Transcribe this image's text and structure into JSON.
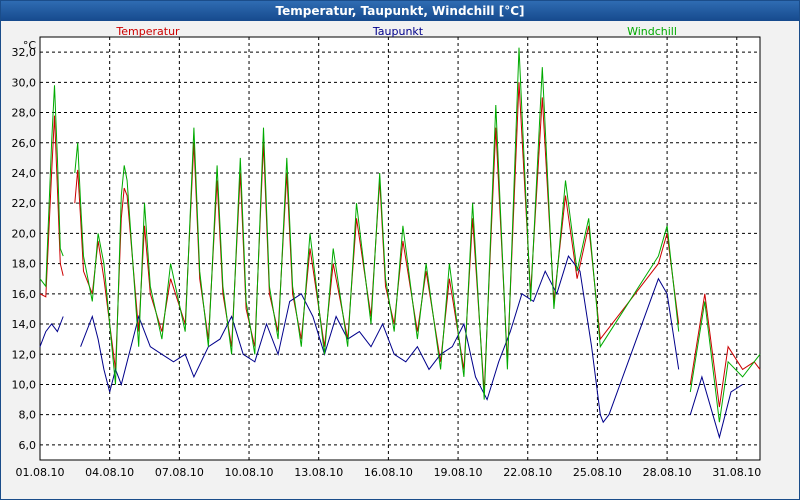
{
  "window": {
    "title": "Temperatur, Taupunkt, Windchill [°C]"
  },
  "chart_data": {
    "type": "line",
    "unit_label": "°C",
    "ylim": [
      5,
      33
    ],
    "xlim": [
      "2010-08-01",
      "2010-09-01"
    ],
    "grid": true,
    "legend_placement": "top",
    "y_ticks": [
      "32,0",
      "30,0",
      "28,0",
      "26,0",
      "24,0",
      "22,0",
      "20,0",
      "18,0",
      "16,0",
      "14,0",
      "12,0",
      "10,0",
      "8,0",
      "6,0"
    ],
    "x_ticks": [
      "01.08.10",
      "04.08.10",
      "07.08.10",
      "10.08.10",
      "13.08.10",
      "16.08.10",
      "19.08.10",
      "22.08.10",
      "25.08.10",
      "28.08.10",
      "31.08.10"
    ],
    "series": [
      {
        "name": "Temperatur",
        "color": "#cc0000",
        "points": [
          [
            "2010-08-01 00:00",
            16.0
          ],
          [
            "2010-08-01 06:00",
            15.8
          ],
          [
            "2010-08-01 12:00",
            24.0
          ],
          [
            "2010-08-01 15:00",
            27.8
          ],
          [
            "2010-08-01 18:00",
            23.0
          ],
          [
            "2010-08-01 21:00",
            18.0
          ],
          [
            "2010-08-02 00:00",
            17.2
          ],
          [
            "2010-08-02 06:00",
            null
          ],
          [
            "2010-08-02 12:00",
            22.0
          ],
          [
            "2010-08-02 15:00",
            24.2
          ],
          [
            "2010-08-02 18:00",
            21.0
          ],
          [
            "2010-08-02 21:00",
            17.5
          ],
          [
            "2010-08-03 06:00",
            16.0
          ],
          [
            "2010-08-03 12:00",
            19.5
          ],
          [
            "2010-08-03 18:00",
            17.0
          ],
          [
            "2010-08-04 06:00",
            11.0
          ],
          [
            "2010-08-04 12:00",
            21.0
          ],
          [
            "2010-08-04 15:00",
            23.0
          ],
          [
            "2010-08-04 18:00",
            22.5
          ],
          [
            "2010-08-05 06:00",
            13.5
          ],
          [
            "2010-08-05 12:00",
            20.5
          ],
          [
            "2010-08-05 18:00",
            16.0
          ],
          [
            "2010-08-06 06:00",
            13.5
          ],
          [
            "2010-08-06 15:00",
            17.0
          ],
          [
            "2010-08-07 06:00",
            14.0
          ],
          [
            "2010-08-07 15:00",
            26.0
          ],
          [
            "2010-08-07 21:00",
            17.0
          ],
          [
            "2010-08-08 06:00",
            13.0
          ],
          [
            "2010-08-08 15:00",
            23.5
          ],
          [
            "2010-08-08 21:00",
            16.0
          ],
          [
            "2010-08-09 06:00",
            12.5
          ],
          [
            "2010-08-09 15:00",
            24.0
          ],
          [
            "2010-08-09 21:00",
            15.0
          ],
          [
            "2010-08-10 06:00",
            12.5
          ],
          [
            "2010-08-10 15:00",
            26.0
          ],
          [
            "2010-08-10 21:00",
            16.0
          ],
          [
            "2010-08-11 06:00",
            13.5
          ],
          [
            "2010-08-11 15:00",
            24.0
          ],
          [
            "2010-08-11 21:00",
            16.0
          ],
          [
            "2010-08-12 06:00",
            13.0
          ],
          [
            "2010-08-12 15:00",
            19.0
          ],
          [
            "2010-08-13 06:00",
            12.5
          ],
          [
            "2010-08-13 15:00",
            18.0
          ],
          [
            "2010-08-14 06:00",
            13.0
          ],
          [
            "2010-08-14 15:00",
            21.0
          ],
          [
            "2010-08-15 06:00",
            14.5
          ],
          [
            "2010-08-15 15:00",
            23.5
          ],
          [
            "2010-08-15 21:00",
            16.5
          ],
          [
            "2010-08-16 06:00",
            14.0
          ],
          [
            "2010-08-16 15:00",
            19.5
          ],
          [
            "2010-08-17 06:00",
            13.5
          ],
          [
            "2010-08-17 15:00",
            17.5
          ],
          [
            "2010-08-18 06:00",
            11.5
          ],
          [
            "2010-08-18 15:00",
            17.0
          ],
          [
            "2010-08-19 06:00",
            11.0
          ],
          [
            "2010-08-19 15:00",
            21.0
          ],
          [
            "2010-08-20 03:00",
            9.5
          ],
          [
            "2010-08-20 15:00",
            27.0
          ],
          [
            "2010-08-21 03:00",
            11.5
          ],
          [
            "2010-08-21 15:00",
            30.0
          ],
          [
            "2010-08-22 03:00",
            16.0
          ],
          [
            "2010-08-22 15:00",
            29.0
          ],
          [
            "2010-08-23 03:00",
            15.5
          ],
          [
            "2010-08-23 15:00",
            22.5
          ],
          [
            "2010-08-24 03:00",
            17.0
          ],
          [
            "2010-08-24 15:00",
            20.5
          ],
          [
            "2010-08-25 03:00",
            13.0
          ],
          [
            "2010-08-27 15:00",
            18.0
          ],
          [
            "2010-08-28 00:00",
            20.0
          ],
          [
            "2010-08-28 12:00",
            14.0
          ],
          [
            "2010-08-28 18:00",
            null
          ],
          [
            "2010-08-29 00:00",
            10.0
          ],
          [
            "2010-08-29 15:00",
            16.0
          ],
          [
            "2010-08-30 06:00",
            8.5
          ],
          [
            "2010-08-30 15:00",
            12.5
          ],
          [
            "2010-08-31 06:00",
            11.0
          ],
          [
            "2010-08-31 18:00",
            11.5
          ],
          [
            "2010-09-01 00:00",
            11.0
          ]
        ]
      },
      {
        "name": "Taupunkt",
        "color": "#00008b",
        "points": [
          [
            "2010-08-01 00:00",
            12.5
          ],
          [
            "2010-08-01 06:00",
            13.5
          ],
          [
            "2010-08-01 12:00",
            14.0
          ],
          [
            "2010-08-01 18:00",
            13.5
          ],
          [
            "2010-08-02 00:00",
            14.5
          ],
          [
            "2010-08-02 06:00",
            null
          ],
          [
            "2010-08-02 18:00",
            12.5
          ],
          [
            "2010-08-03 06:00",
            14.5
          ],
          [
            "2010-08-03 12:00",
            13.0
          ],
          [
            "2010-08-03 18:00",
            11.0
          ],
          [
            "2010-08-04 00:00",
            9.5
          ],
          [
            "2010-08-04 06:00",
            11.0
          ],
          [
            "2010-08-04 12:00",
            10.0
          ],
          [
            "2010-08-05 06:00",
            14.5
          ],
          [
            "2010-08-05 12:00",
            13.5
          ],
          [
            "2010-08-05 18:00",
            12.5
          ],
          [
            "2010-08-06 06:00",
            12.0
          ],
          [
            "2010-08-06 18:00",
            11.5
          ],
          [
            "2010-08-07 06:00",
            12.0
          ],
          [
            "2010-08-07 15:00",
            10.5
          ],
          [
            "2010-08-08 06:00",
            12.5
          ],
          [
            "2010-08-08 18:00",
            13.0
          ],
          [
            "2010-08-09 06:00",
            14.5
          ],
          [
            "2010-08-09 18:00",
            12.0
          ],
          [
            "2010-08-10 06:00",
            11.5
          ],
          [
            "2010-08-10 18:00",
            14.0
          ],
          [
            "2010-08-11 06:00",
            12.0
          ],
          [
            "2010-08-11 18:00",
            15.5
          ],
          [
            "2010-08-12 06:00",
            16.0
          ],
          [
            "2010-08-12 18:00",
            14.5
          ],
          [
            "2010-08-13 06:00",
            12.0
          ],
          [
            "2010-08-13 18:00",
            14.5
          ],
          [
            "2010-08-14 06:00",
            13.0
          ],
          [
            "2010-08-14 18:00",
            13.5
          ],
          [
            "2010-08-15 06:00",
            12.5
          ],
          [
            "2010-08-15 18:00",
            14.0
          ],
          [
            "2010-08-16 06:00",
            12.0
          ],
          [
            "2010-08-16 18:00",
            11.5
          ],
          [
            "2010-08-17 06:00",
            12.5
          ],
          [
            "2010-08-17 18:00",
            11.0
          ],
          [
            "2010-08-18 06:00",
            12.0
          ],
          [
            "2010-08-18 18:00",
            12.5
          ],
          [
            "2010-08-19 06:00",
            14.0
          ],
          [
            "2010-08-19 18:00",
            10.5
          ],
          [
            "2010-08-20 06:00",
            9.0
          ],
          [
            "2010-08-20 18:00",
            11.5
          ],
          [
            "2010-08-21 06:00",
            13.5
          ],
          [
            "2010-08-21 18:00",
            16.0
          ],
          [
            "2010-08-22 06:00",
            15.5
          ],
          [
            "2010-08-22 18:00",
            17.5
          ],
          [
            "2010-08-23 06:00",
            16.0
          ],
          [
            "2010-08-23 18:00",
            18.5
          ],
          [
            "2010-08-24 06:00",
            17.5
          ],
          [
            "2010-08-24 18:00",
            12.5
          ],
          [
            "2010-08-25 03:00",
            8.0
          ],
          [
            "2010-08-25 06:00",
            7.5
          ],
          [
            "2010-08-25 12:00",
            8.0
          ],
          [
            "2010-08-27 15:00",
            17.0
          ],
          [
            "2010-08-28 00:00",
            16.0
          ],
          [
            "2010-08-28 12:00",
            11.0
          ],
          [
            "2010-08-28 18:00",
            null
          ],
          [
            "2010-08-29 00:00",
            8.0
          ],
          [
            "2010-08-29 12:00",
            10.5
          ],
          [
            "2010-08-30 06:00",
            6.5
          ],
          [
            "2010-08-30 18:00",
            9.5
          ],
          [
            "2010-08-31 06:00",
            10.0
          ],
          [
            "2010-08-31 18:00",
            null
          ],
          [
            "2010-09-01 00:00",
            7.0
          ]
        ]
      },
      {
        "name": "Windchill",
        "color": "#00aa00",
        "points": [
          [
            "2010-08-01 00:00",
            17.0
          ],
          [
            "2010-08-01 06:00",
            16.5
          ],
          [
            "2010-08-01 12:00",
            26.0
          ],
          [
            "2010-08-01 15:00",
            29.8
          ],
          [
            "2010-08-01 18:00",
            25.0
          ],
          [
            "2010-08-01 21:00",
            19.0
          ],
          [
            "2010-08-02 00:00",
            18.5
          ],
          [
            "2010-08-02 06:00",
            null
          ],
          [
            "2010-08-02 12:00",
            24.0
          ],
          [
            "2010-08-02 15:00",
            26.0
          ],
          [
            "2010-08-02 18:00",
            22.0
          ],
          [
            "2010-08-02 21:00",
            18.5
          ],
          [
            "2010-08-03 06:00",
            15.5
          ],
          [
            "2010-08-03 12:00",
            20.0
          ],
          [
            "2010-08-03 18:00",
            18.0
          ],
          [
            "2010-08-04 06:00",
            10.0
          ],
          [
            "2010-08-04 12:00",
            22.5
          ],
          [
            "2010-08-04 15:00",
            24.5
          ],
          [
            "2010-08-04 18:00",
            23.5
          ],
          [
            "2010-08-05 06:00",
            12.5
          ],
          [
            "2010-08-05 12:00",
            22.0
          ],
          [
            "2010-08-05 18:00",
            16.5
          ],
          [
            "2010-08-06 06:00",
            13.0
          ],
          [
            "2010-08-06 15:00",
            18.0
          ],
          [
            "2010-08-07 06:00",
            13.5
          ],
          [
            "2010-08-07 15:00",
            27.0
          ],
          [
            "2010-08-07 21:00",
            17.5
          ],
          [
            "2010-08-08 06:00",
            12.5
          ],
          [
            "2010-08-08 15:00",
            24.5
          ],
          [
            "2010-08-08 21:00",
            16.5
          ],
          [
            "2010-08-09 06:00",
            12.0
          ],
          [
            "2010-08-09 15:00",
            25.0
          ],
          [
            "2010-08-09 21:00",
            15.5
          ],
          [
            "2010-08-10 06:00",
            12.0
          ],
          [
            "2010-08-10 15:00",
            27.0
          ],
          [
            "2010-08-10 21:00",
            16.5
          ],
          [
            "2010-08-11 06:00",
            13.0
          ],
          [
            "2010-08-11 15:00",
            25.0
          ],
          [
            "2010-08-11 21:00",
            16.5
          ],
          [
            "2010-08-12 06:00",
            12.5
          ],
          [
            "2010-08-12 15:00",
            20.0
          ],
          [
            "2010-08-13 06:00",
            12.0
          ],
          [
            "2010-08-13 15:00",
            19.0
          ],
          [
            "2010-08-14 06:00",
            12.5
          ],
          [
            "2010-08-14 15:00",
            22.0
          ],
          [
            "2010-08-15 06:00",
            14.0
          ],
          [
            "2010-08-15 15:00",
            24.0
          ],
          [
            "2010-08-15 21:00",
            17.0
          ],
          [
            "2010-08-16 06:00",
            13.5
          ],
          [
            "2010-08-16 15:00",
            20.5
          ],
          [
            "2010-08-17 06:00",
            13.0
          ],
          [
            "2010-08-17 15:00",
            18.0
          ],
          [
            "2010-08-18 06:00",
            11.0
          ],
          [
            "2010-08-18 15:00",
            18.0
          ],
          [
            "2010-08-19 06:00",
            10.5
          ],
          [
            "2010-08-19 15:00",
            22.0
          ],
          [
            "2010-08-20 03:00",
            9.0
          ],
          [
            "2010-08-20 15:00",
            28.5
          ],
          [
            "2010-08-21 03:00",
            11.0
          ],
          [
            "2010-08-21 15:00",
            32.3
          ],
          [
            "2010-08-22 03:00",
            15.5
          ],
          [
            "2010-08-22 15:00",
            31.0
          ],
          [
            "2010-08-23 03:00",
            15.0
          ],
          [
            "2010-08-23 15:00",
            23.5
          ],
          [
            "2010-08-24 03:00",
            17.5
          ],
          [
            "2010-08-24 15:00",
            21.0
          ],
          [
            "2010-08-25 03:00",
            12.5
          ],
          [
            "2010-08-27 15:00",
            18.5
          ],
          [
            "2010-08-28 00:00",
            20.5
          ],
          [
            "2010-08-28 12:00",
            13.5
          ],
          [
            "2010-08-28 18:00",
            null
          ],
          [
            "2010-08-29 00:00",
            9.5
          ],
          [
            "2010-08-29 15:00",
            15.5
          ],
          [
            "2010-08-30 06:00",
            7.5
          ],
          [
            "2010-08-30 15:00",
            11.5
          ],
          [
            "2010-08-31 06:00",
            10.5
          ],
          [
            "2010-08-31 18:00",
            11.5
          ],
          [
            "2010-09-01 00:00",
            12.0
          ]
        ]
      }
    ]
  }
}
